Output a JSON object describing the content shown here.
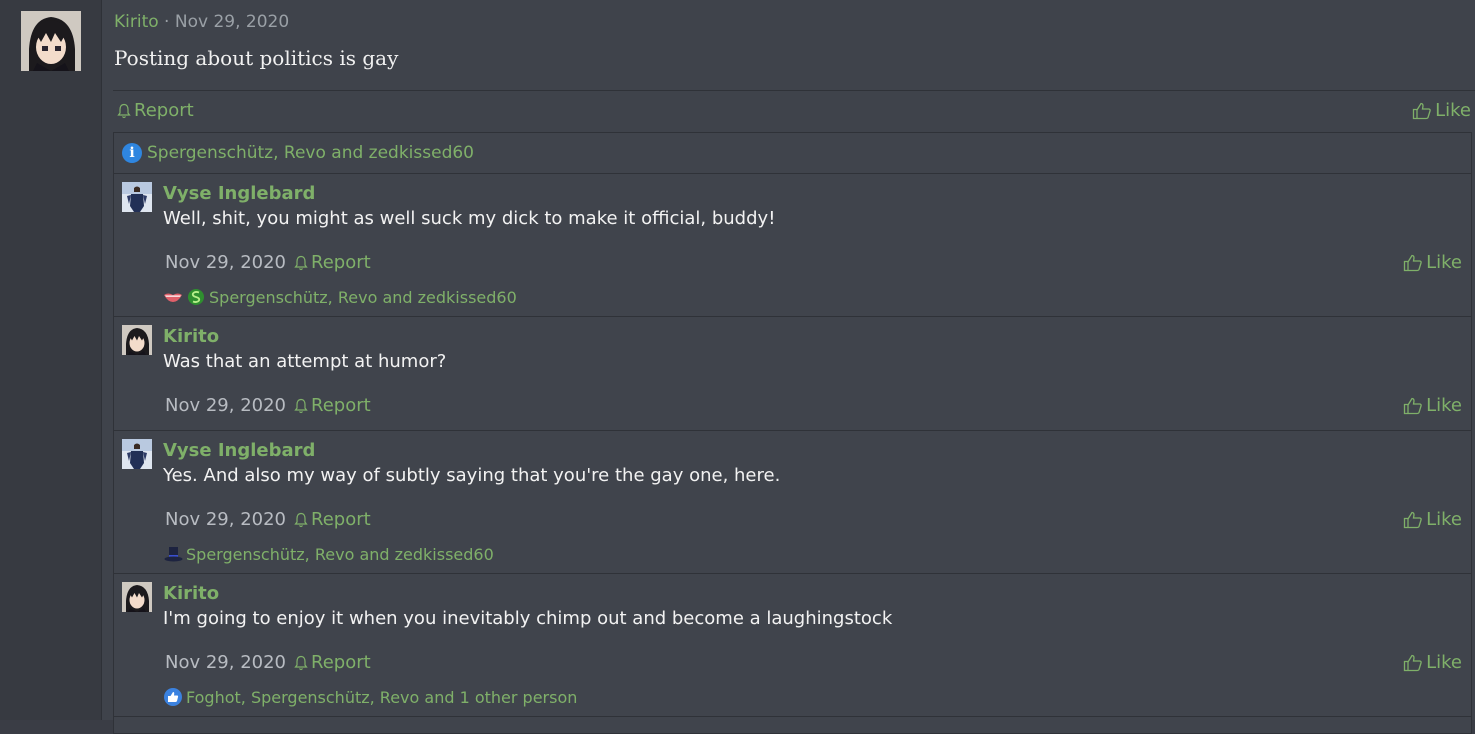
{
  "post": {
    "author": "Kirito",
    "separator": " · ",
    "date": "Nov 29, 2020",
    "text": "Posting about politics is gay",
    "report_label": "Report",
    "like_label": "Like"
  },
  "reactions_summary": {
    "icon": "info-icon",
    "text": "Spergenschütz, Revo and zedkissed60"
  },
  "comments": [
    {
      "author": "Vyse Inglebard",
      "text": "Well, shit, you might as well suck my dick to make it official, buddy!",
      "date": "Nov 29, 2020",
      "report_label": "Report",
      "like_label": "Like",
      "reactions": {
        "icons": [
          "lips-icon",
          "dollar-laugh-icon"
        ],
        "text": "Spergenschütz, Revo and zedkissed60"
      }
    },
    {
      "author": "Kirito",
      "text": "Was that an attempt at humor?",
      "date": "Nov 29, 2020",
      "report_label": "Report",
      "like_label": "Like"
    },
    {
      "author": "Vyse Inglebard",
      "text": "Yes. And also my way of subtly saying that you're the gay one, here.",
      "date": "Nov 29, 2020",
      "report_label": "Report",
      "like_label": "Like",
      "reactions": {
        "icons": [
          "top-hat-icon"
        ],
        "text": "Spergenschütz, Revo and zedkissed60"
      }
    },
    {
      "author": "Kirito",
      "text": "I'm going to enjoy it when you inevitably chimp out and become a laughingstock",
      "date": "Nov 29, 2020",
      "report_label": "Report",
      "like_label": "Like",
      "reactions": {
        "icons": [
          "thumbs-up-icon"
        ],
        "text": "Foghot, Spergenschütz, Revo and 1 other person"
      }
    }
  ],
  "colors": {
    "accent": "#7fb069",
    "background": "#3f434b",
    "info": "#2f86e0"
  }
}
